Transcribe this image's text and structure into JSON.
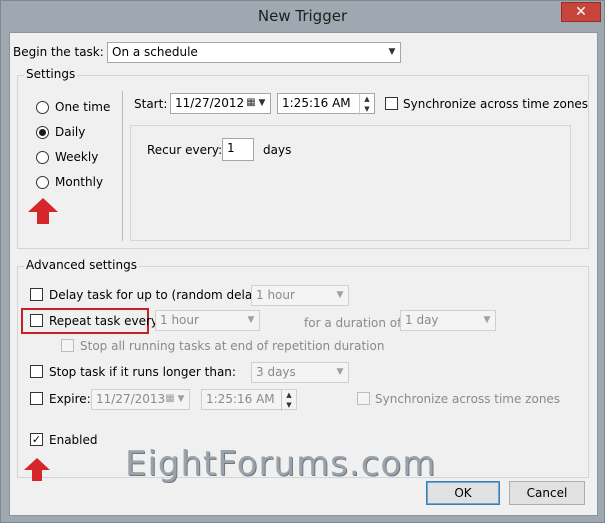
{
  "window": {
    "title": "New Trigger",
    "close_glyph": "✕"
  },
  "begin_task": {
    "label": "Begin the task:",
    "value": "On a schedule"
  },
  "settings": {
    "legend": "Settings",
    "options": [
      {
        "label": "One time",
        "checked": false
      },
      {
        "label": "Daily",
        "checked": true
      },
      {
        "label": "Weekly",
        "checked": false
      },
      {
        "label": "Monthly",
        "checked": false
      }
    ],
    "start_label": "Start:",
    "start_date": "11/27/2012",
    "start_time": "1:25:16 AM",
    "sync_label": "Synchronize across time zones",
    "recur_label": "Recur every:",
    "recur_value": "1",
    "recur_unit": "days"
  },
  "advanced": {
    "legend": "Advanced settings",
    "delay_label": "Delay task for up to (random delay):",
    "delay_value": "1 hour",
    "repeat_label": "Repeat task every:",
    "repeat_value": "1 hour",
    "duration_label": "for a duration of:",
    "duration_value": "1 day",
    "stop_repetition_label": "Stop all running tasks at end of repetition duration",
    "stop_long_label": "Stop task if it runs longer than:",
    "stop_long_value": "3 days",
    "expire_label": "Expire:",
    "expire_date": "11/27/2013",
    "expire_time": "1:25:16 AM",
    "expire_sync_label": "Synchronize across time zones",
    "enabled_label": "Enabled",
    "check_glyph": "✓"
  },
  "buttons": {
    "ok": "OK",
    "cancel": "Cancel"
  },
  "watermark": "EightForums.com",
  "icons": {
    "calendar": "calendar-icon",
    "dropdown": "chevron-down-icon",
    "spin": "spin-icon"
  },
  "colors": {
    "accent_red": "#d7262b",
    "titlebar": "#9fa7b1",
    "close": "#c7463b"
  }
}
